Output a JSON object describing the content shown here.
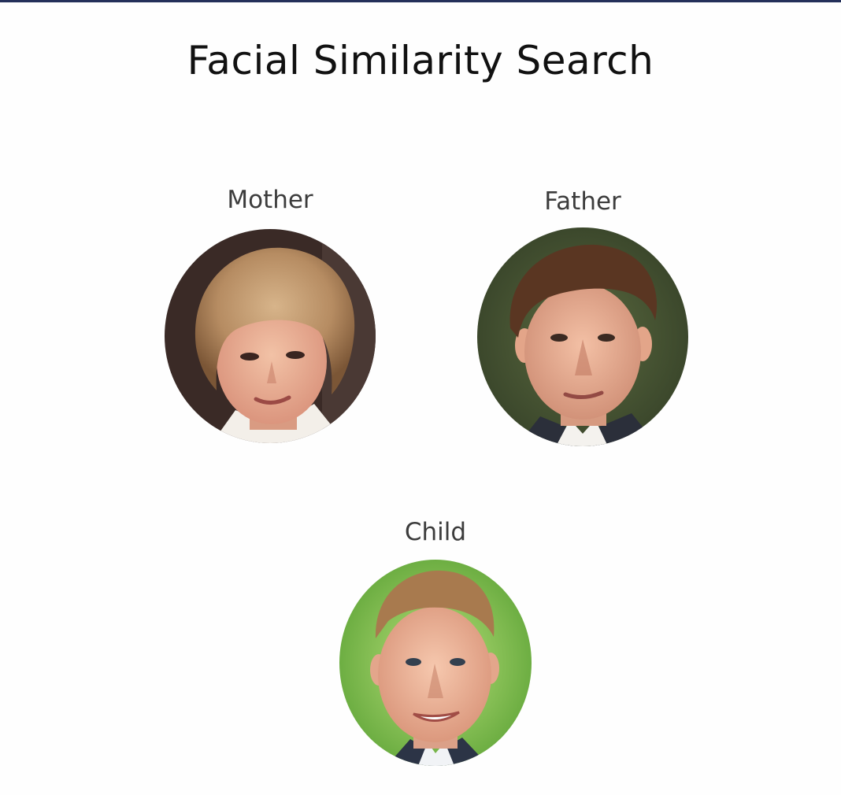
{
  "page": {
    "title": "Facial Similarity Search"
  },
  "people": {
    "mother": {
      "label": "Mother"
    },
    "father": {
      "label": "Father"
    },
    "child": {
      "label": "Child"
    }
  },
  "colors": {
    "accent_rule": "#24305a",
    "title_text": "#111111",
    "label_text": "#3c3c3c",
    "background": "#fefefe"
  }
}
